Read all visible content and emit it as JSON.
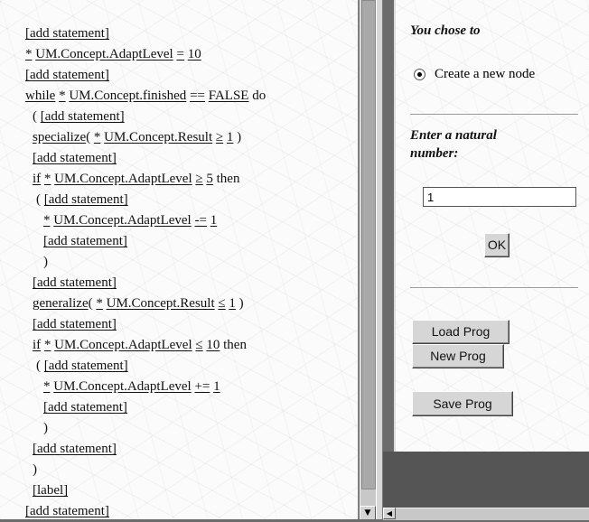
{
  "editor": {
    "lines": [
      {
        "parts": [
          {
            "t": "[add statement]",
            "u": true
          }
        ],
        "indent": 0
      },
      {
        "parts": [
          {
            "t": "*",
            "u": true
          },
          {
            "t": " "
          },
          {
            "t": "UM.Concept.AdaptLevel",
            "u": true
          },
          {
            "t": " "
          },
          {
            "t": "=",
            "u": true
          },
          {
            "t": " "
          },
          {
            "t": "10",
            "u": true
          }
        ],
        "indent": 0
      },
      {
        "parts": [
          {
            "t": "[add statement]",
            "u": true
          }
        ],
        "indent": 0
      },
      {
        "parts": [
          {
            "t": "while",
            "u": true
          },
          {
            "t": " "
          },
          {
            "t": "*",
            "u": true
          },
          {
            "t": " "
          },
          {
            "t": "UM.Concept.finished",
            "u": true
          },
          {
            "t": " "
          },
          {
            "t": "==",
            "u": true
          },
          {
            "t": " "
          },
          {
            "t": "FALSE",
            "u": true
          },
          {
            "t": " do"
          }
        ],
        "indent": 0
      },
      {
        "parts": [
          {
            "t": "( "
          },
          {
            "t": "[add statement]",
            "u": true
          }
        ],
        "indent": 1
      },
      {
        "parts": [
          {
            "t": "specialize",
            "u": true
          },
          {
            "t": "( "
          },
          {
            "t": "*",
            "u": true
          },
          {
            "t": " "
          },
          {
            "t": "UM.Concept.Result",
            "u": true
          },
          {
            "t": " "
          },
          {
            "t": "≥",
            "u": true
          },
          {
            "t": " "
          },
          {
            "t": "1",
            "u": true
          },
          {
            "t": " )"
          }
        ],
        "indent": 1
      },
      {
        "parts": [
          {
            "t": "[add statement]",
            "u": true
          }
        ],
        "indent": 1
      },
      {
        "parts": [
          {
            "t": "if",
            "u": true
          },
          {
            "t": " "
          },
          {
            "t": "*",
            "u": true
          },
          {
            "t": " "
          },
          {
            "t": "UM.Concept.AdaptLevel",
            "u": true
          },
          {
            "t": " "
          },
          {
            "t": "≥",
            "u": true
          },
          {
            "t": " "
          },
          {
            "t": "5",
            "u": true
          },
          {
            "t": " then"
          }
        ],
        "indent": 1
      },
      {
        "parts": [
          {
            "t": "( "
          },
          {
            "t": "[add statement]",
            "u": true
          }
        ],
        "indent": 2
      },
      {
        "parts": [
          {
            "t": "*",
            "u": true
          },
          {
            "t": " "
          },
          {
            "t": "UM.Concept.AdaptLevel",
            "u": true
          },
          {
            "t": " "
          },
          {
            "t": "-=",
            "u": true
          },
          {
            "t": " "
          },
          {
            "t": "1",
            "u": true
          }
        ],
        "indent": 3
      },
      {
        "parts": [
          {
            "t": "[add statement]",
            "u": true
          }
        ],
        "indent": 3
      },
      {
        "parts": [
          {
            "t": ")"
          }
        ],
        "indent": 3
      },
      {
        "parts": [
          {
            "t": "[add statement]",
            "u": true
          }
        ],
        "indent": 1
      },
      {
        "parts": [
          {
            "t": "generalize",
            "u": true
          },
          {
            "t": "( "
          },
          {
            "t": "*",
            "u": true
          },
          {
            "t": " "
          },
          {
            "t": "UM.Concept.Result",
            "u": true
          },
          {
            "t": " "
          },
          {
            "t": "≤",
            "u": true
          },
          {
            "t": " "
          },
          {
            "t": "1",
            "u": true
          },
          {
            "t": " )"
          }
        ],
        "indent": 1
      },
      {
        "parts": [
          {
            "t": "[add statement]",
            "u": true
          }
        ],
        "indent": 1
      },
      {
        "parts": [
          {
            "t": "if",
            "u": true
          },
          {
            "t": " "
          },
          {
            "t": "*",
            "u": true
          },
          {
            "t": " "
          },
          {
            "t": "UM.Concept.AdaptLevel",
            "u": true
          },
          {
            "t": " "
          },
          {
            "t": "≤",
            "u": true
          },
          {
            "t": " "
          },
          {
            "t": "10",
            "u": true
          },
          {
            "t": " then"
          }
        ],
        "indent": 1
      },
      {
        "parts": [
          {
            "t": "( "
          },
          {
            "t": "[add statement]",
            "u": true
          }
        ],
        "indent": 2
      },
      {
        "parts": [
          {
            "t": "*",
            "u": true
          },
          {
            "t": " "
          },
          {
            "t": "UM.Concept.AdaptLevel",
            "u": true
          },
          {
            "t": " "
          },
          {
            "t": "+=",
            "u": true
          },
          {
            "t": " "
          },
          {
            "t": "1",
            "u": true
          }
        ],
        "indent": 3
      },
      {
        "parts": [
          {
            "t": "[add statement]",
            "u": true
          }
        ],
        "indent": 3
      },
      {
        "parts": [
          {
            "t": ")"
          }
        ],
        "indent": 3
      },
      {
        "parts": [
          {
            "t": "[add statement]",
            "u": true
          }
        ],
        "indent": 1
      },
      {
        "parts": [
          {
            "t": ")"
          }
        ],
        "indent": 1
      },
      {
        "parts": [
          {
            "t": "[label]",
            "u": true
          }
        ],
        "indent": 1
      },
      {
        "parts": [
          {
            "t": "[add statement]",
            "u": true
          }
        ],
        "indent": 0
      }
    ]
  },
  "panel": {
    "chose_heading": "You chose to",
    "radio_label": "Create a new node",
    "prompt_heading_line1": "Enter a natural",
    "prompt_heading_line2": "number:",
    "number_value": "1",
    "ok_label": "OK",
    "load_label": "Load Prog",
    "new_label": "New Prog",
    "save_label": "Save Prog"
  },
  "icons": {
    "scroll_down": "arrow-down-icon",
    "scroll_left": "arrow-left-icon"
  }
}
